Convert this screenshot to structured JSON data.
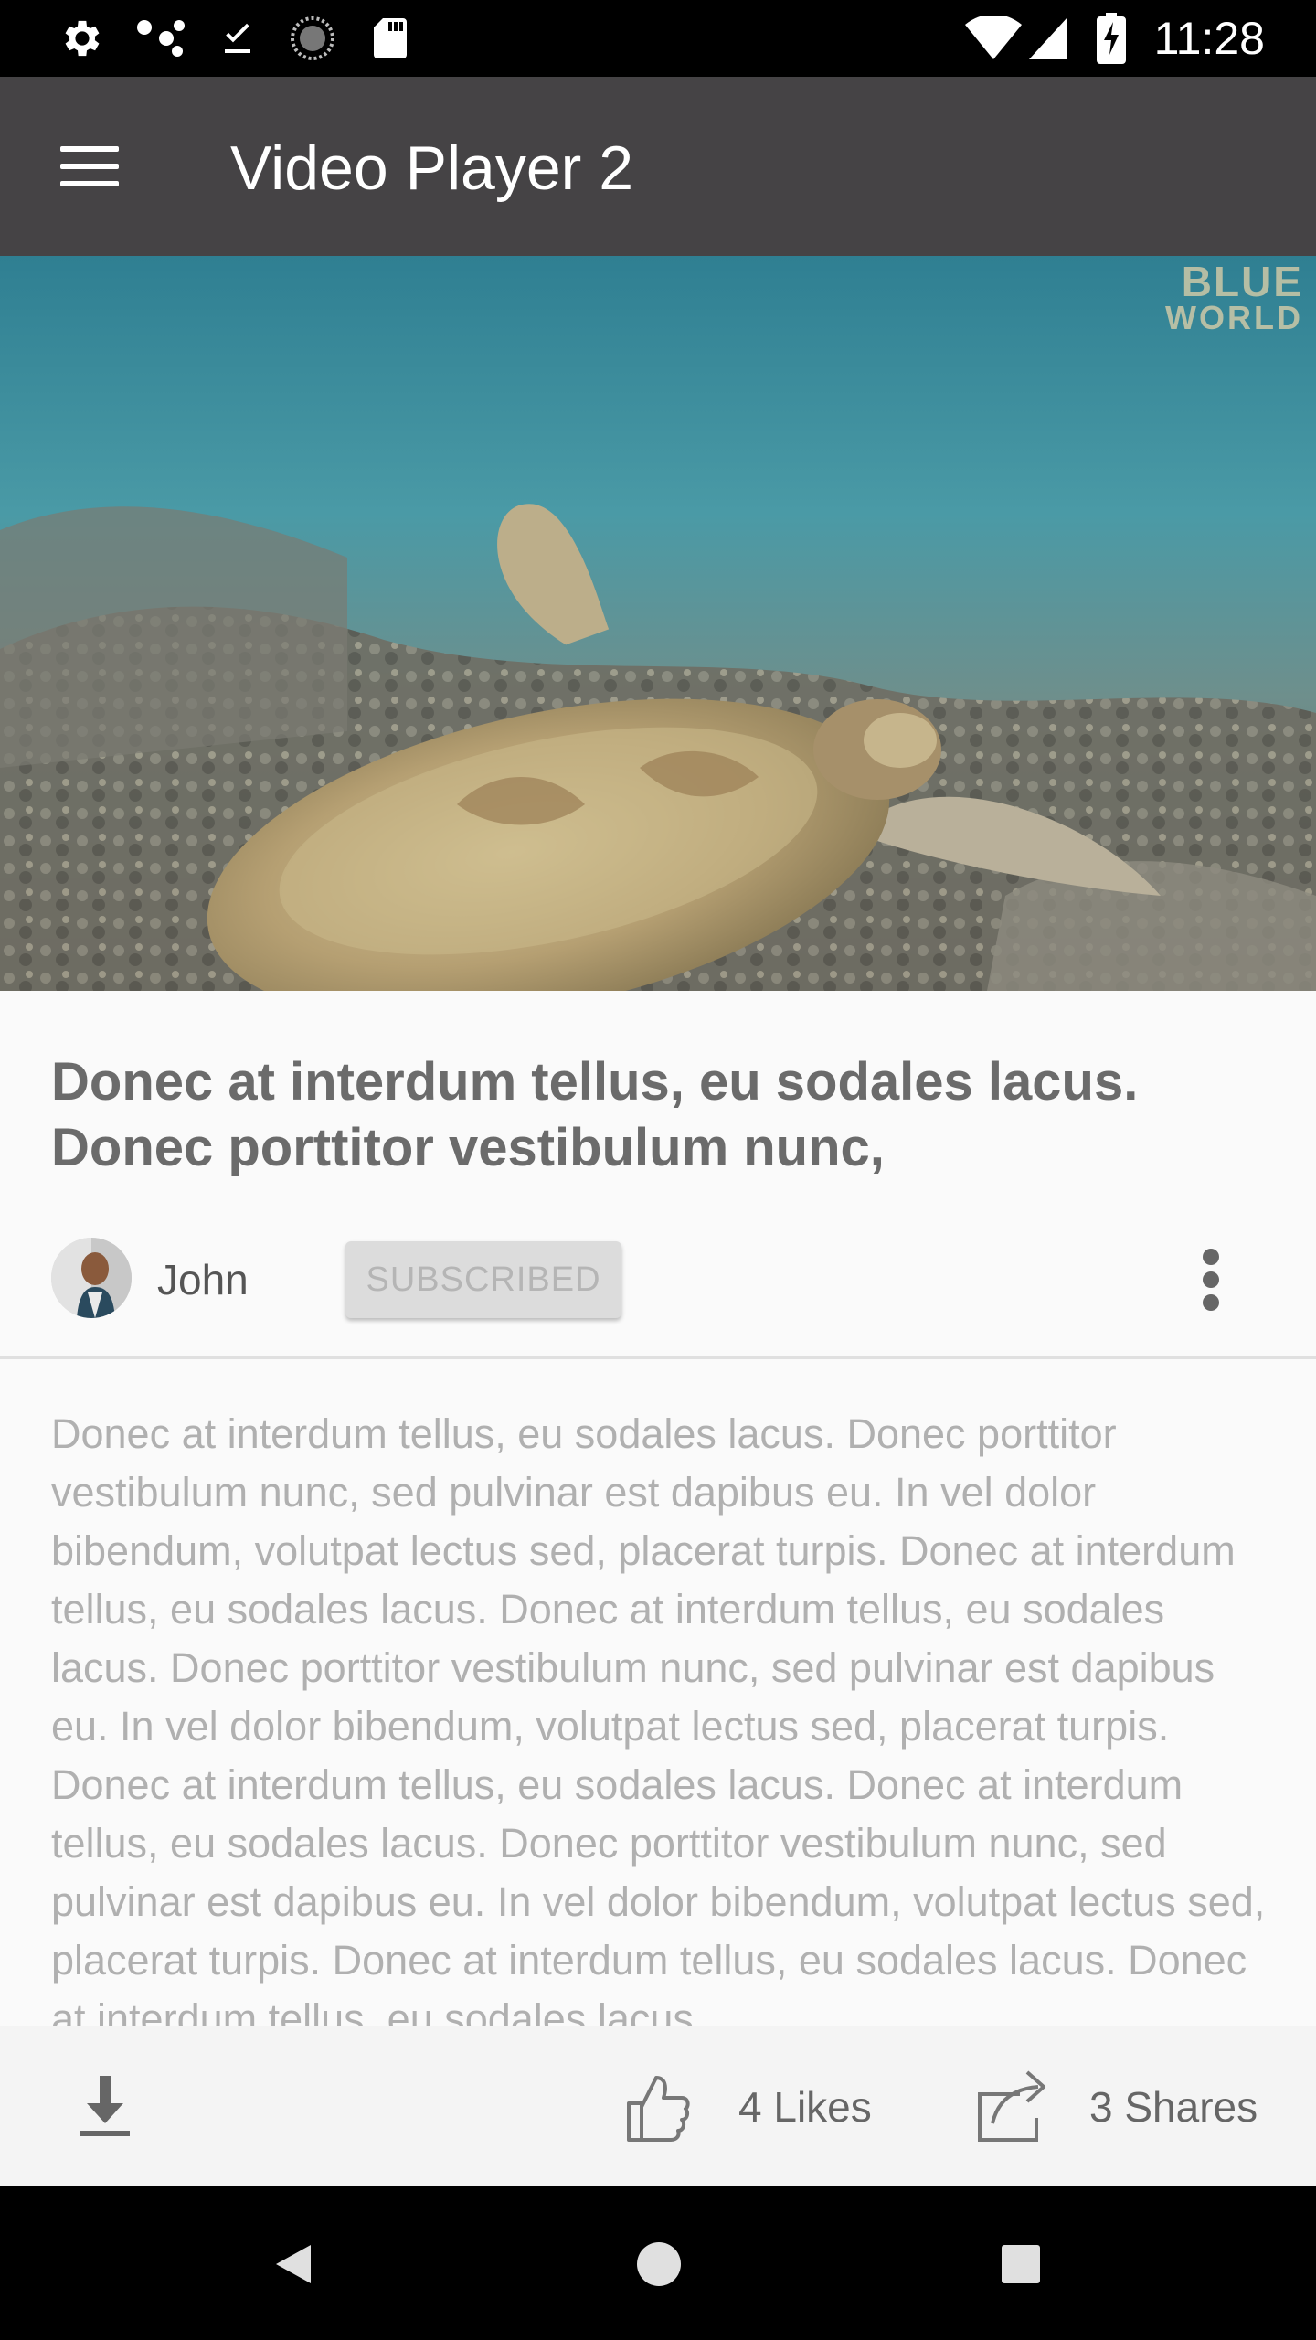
{
  "status_bar": {
    "time": "11:28",
    "left_icons": [
      "settings-icon",
      "nodes-icon",
      "download-done-icon",
      "sync-circle-icon",
      "sd-card-icon"
    ],
    "right_icons": [
      "wifi-icon",
      "signal-icon",
      "battery-charging-icon"
    ]
  },
  "app_bar": {
    "title": "Video Player 2",
    "menu_icon": "hamburger-menu-icon"
  },
  "video": {
    "watermark_line1": "BLUE",
    "watermark_line2": "WORLD"
  },
  "video_info": {
    "title": "Donec at interdum tellus, eu sodales lacus. Donec porttitor vestibulum nunc,",
    "channel_name": "John",
    "subscribe_label": "SUBSCRIBED",
    "description": "Donec at interdum tellus, eu sodales lacus. Donec porttitor vestibulum nunc, sed pulvinar est dapibus eu. In vel dolor bibendum, volutpat lectus sed, placerat turpis. Donec at interdum tellus, eu sodales lacus.  Donec at interdum tellus, eu sodales lacus. Donec porttitor vestibulum nunc, sed pulvinar est dapibus eu. In vel dolor bibendum, volutpat lectus sed, placerat turpis. Donec at interdum tellus, eu sodales lacus.  Donec at interdum tellus, eu sodales lacus. Donec porttitor vestibulum nunc, sed pulvinar est dapibus eu. In vel dolor bibendum, volutpat lectus sed, placerat turpis. Donec at interdum tellus, eu sodales lacus.  Donec at interdum tellus, eu sodales lacus."
  },
  "actions": {
    "likes_label": "4 Likes",
    "shares_label": "3 Shares"
  },
  "nav_bar": {
    "buttons": [
      "back-triangle-icon",
      "home-circle-icon",
      "recents-square-icon"
    ]
  }
}
